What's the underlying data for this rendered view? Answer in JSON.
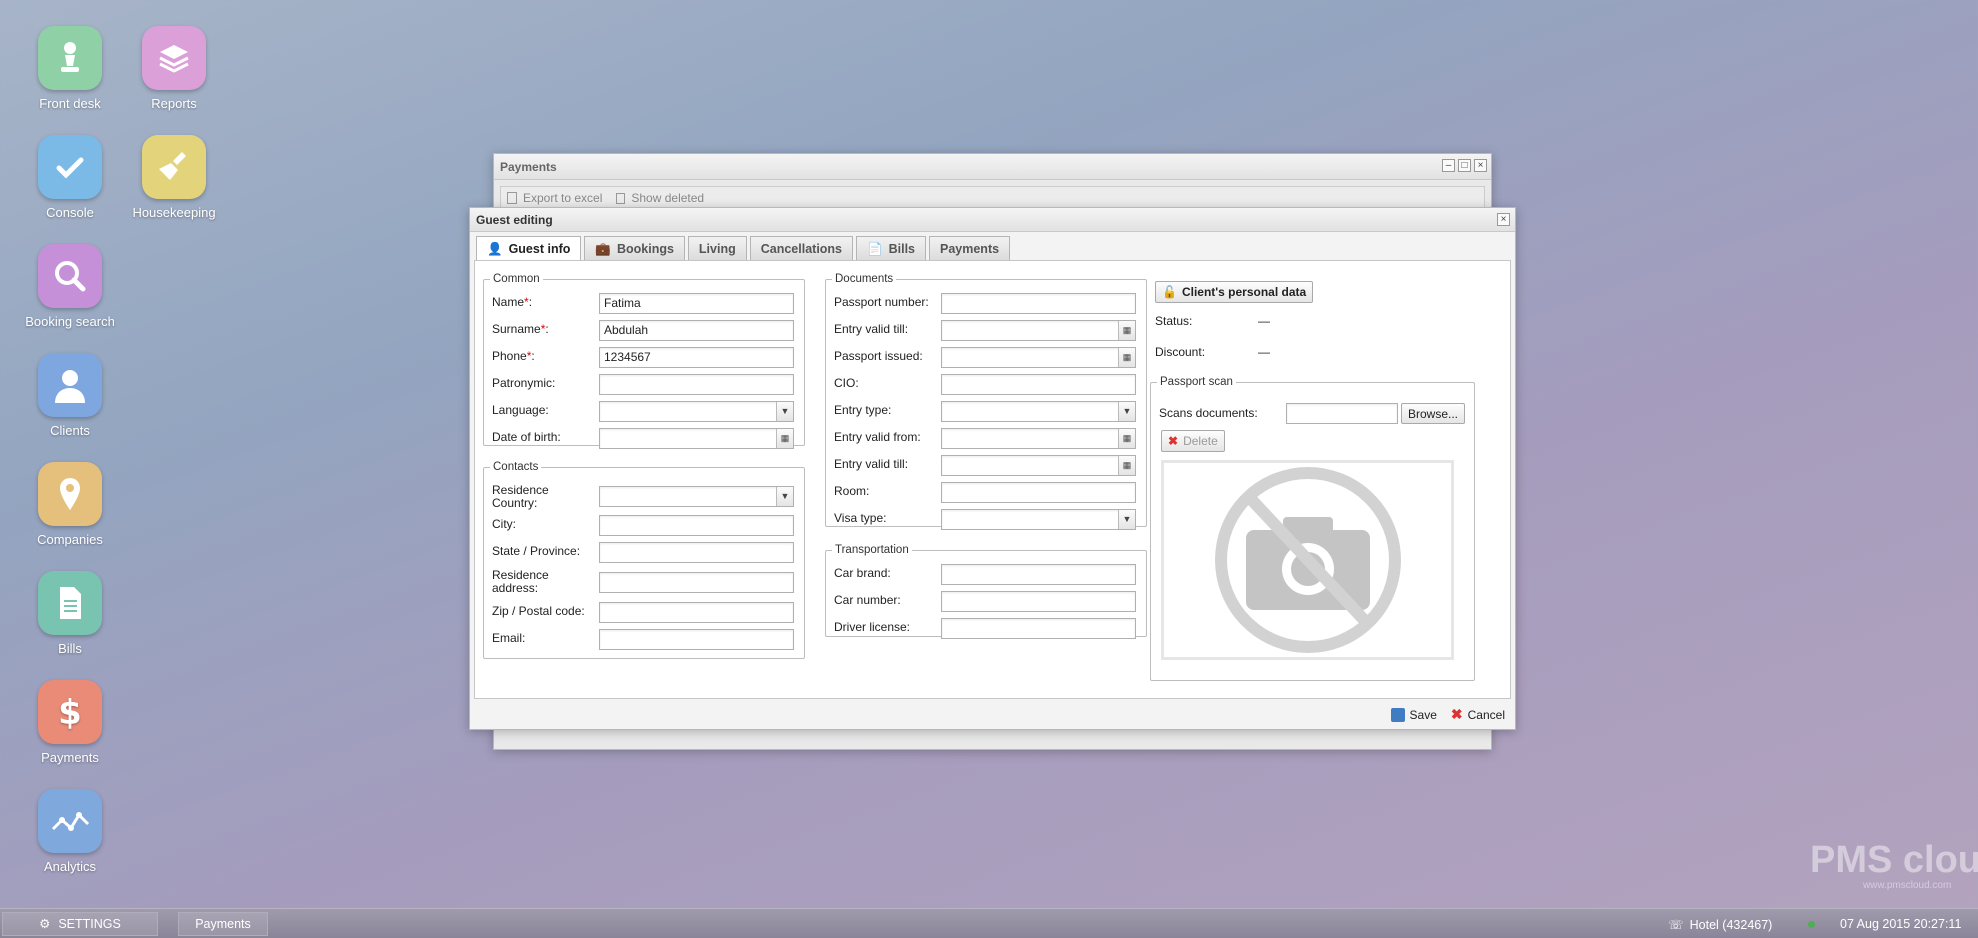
{
  "desktop": {
    "icons": [
      {
        "label": "Front desk",
        "color": "#8fd0a6",
        "icon": "pawn-icon"
      },
      {
        "label": "Reports",
        "color": "#dba0d8",
        "icon": "books-icon"
      },
      {
        "label": "Console",
        "color": "#7bb9e6",
        "icon": "check-icon"
      },
      {
        "label": "Housekeeping",
        "color": "#e3d47b",
        "icon": "broom-icon"
      },
      {
        "label": "Booking search",
        "color": "#c690d8",
        "icon": "magnifier-icon"
      },
      {
        "label": "Clients",
        "color": "#7ea7e0",
        "icon": "person-icon"
      },
      {
        "label": "Companies",
        "color": "#e4c07c",
        "icon": "location-pin-icon"
      },
      {
        "label": "Bills",
        "color": "#79c3b1",
        "icon": "document-icon"
      },
      {
        "label": "Payments",
        "color": "#ea8b78",
        "icon": "dollar-icon"
      },
      {
        "label": "Analytics",
        "color": "#7fa8dc",
        "icon": "chart-line-icon"
      }
    ]
  },
  "payments_window": {
    "title": "Payments",
    "export_label": "Export to excel",
    "show_deleted_label": "Show deleted"
  },
  "dialog": {
    "title": "Guest editing",
    "tabs": [
      {
        "label": "Guest info",
        "icon": "user-icon",
        "active": true
      },
      {
        "label": "Bookings",
        "icon": "briefcase-icon"
      },
      {
        "label": "Living"
      },
      {
        "label": "Cancellations"
      },
      {
        "label": "Bills",
        "icon": "document-icon"
      },
      {
        "label": "Payments"
      }
    ],
    "common": {
      "legend": "Common",
      "name_label": "Name",
      "name_value": "Fatima",
      "surname_label": "Surname",
      "surname_value": "Abdulah",
      "phone_label": "Phone",
      "phone_value": "1234567",
      "patronymic_label": "Patronymic:",
      "language_label": "Language:",
      "dob_label": "Date of birth:",
      "required_mark": "*",
      "colon": ":"
    },
    "contacts": {
      "legend": "Contacts",
      "country_label": "Residence Country:",
      "city_label": "City:",
      "state_label": "State / Province:",
      "address_label": "Residence address:",
      "zip_label": "Zip / Postal code:",
      "email_label": "Email:"
    },
    "documents": {
      "legend": "Documents",
      "passport_number": "Passport number:",
      "entry_valid_till": "Entry valid till:",
      "passport_issued": "Passport issued:",
      "cio": "CIO:",
      "entry_type": "Entry type:",
      "entry_valid_from": "Entry valid from:",
      "entry_valid_till2": "Entry valid till:",
      "room": "Room:",
      "visa_type": "Visa type:"
    },
    "transportation": {
      "legend": "Transportation",
      "car_brand": "Car brand:",
      "car_number": "Car number:",
      "driver_license": "Driver license:"
    },
    "personal": {
      "button_label": "Client's personal data",
      "status_label": "Status:",
      "status_value": "—",
      "discount_label": "Discount:",
      "discount_value": "—"
    },
    "passport_scan": {
      "legend": "Passport scan",
      "scans_label": "Scans documents:",
      "browse_label": "Browse...",
      "delete_label": "Delete"
    },
    "footer": {
      "save_label": "Save",
      "cancel_label": "Cancel"
    }
  },
  "watermark": {
    "brand": "PMS cloud",
    "url": "www.pmscloud.com"
  },
  "taskbar": {
    "settings_label": "SETTINGS",
    "payments_label": "Payments",
    "hotel_label": "Hotel (432467)",
    "datetime": "07 Aug 2015 20:27:11"
  },
  "colors": {
    "required": "#dd0000",
    "status_dot": "#4caf50"
  }
}
